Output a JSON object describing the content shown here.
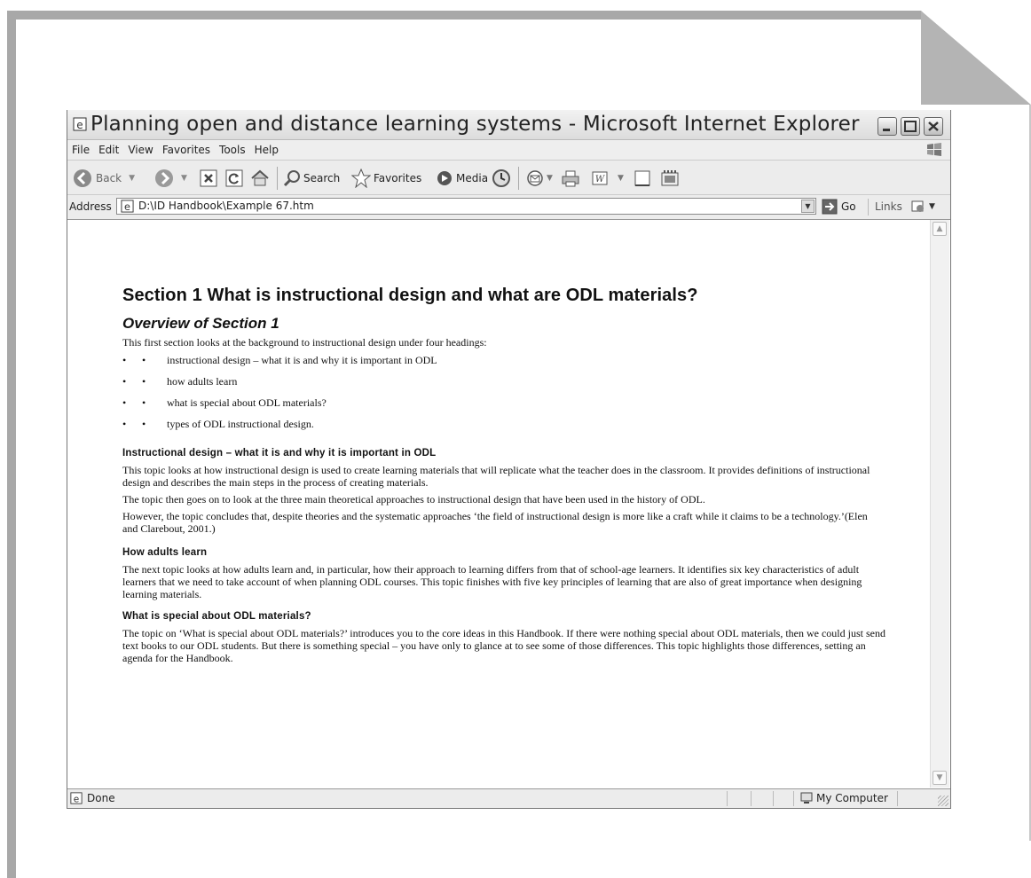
{
  "window": {
    "title": "Planning open and distance learning systems - Microsoft Internet Explorer"
  },
  "menu": [
    "File",
    "Edit",
    "View",
    "Favorites",
    "Tools",
    "Help"
  ],
  "toolbar": {
    "back": "Back",
    "search": "Search",
    "favorites": "Favorites",
    "media": "Media"
  },
  "address": {
    "label": "Address",
    "value": "D:\\ID Handbook\\Example 67.htm",
    "go": "Go",
    "links": "Links"
  },
  "content": {
    "heading": "Section 1 What is instructional design and what are ODL materials?",
    "subheading": "Overview of Section 1",
    "intro": "This first section looks at the background to instructional design under four headings:",
    "bullet_glyph": "•",
    "bullets": [
      "instructional design – what it is and why it is important in ODL",
      "how adults learn",
      "what is special about ODL materials?",
      "types of ODL instructional design."
    ],
    "sections": [
      {
        "title": "Instructional design – what it is and why it is important in ODL",
        "paragraphs": [
          "This topic looks at how instructional design is used to create learning materials that will replicate what the teacher does in the classroom. It provides definitions of instructional design and describes the main steps in the process of creating materials.",
          "The topic then goes on to look at the three main theoretical approaches to instructional design that have been used in the history of ODL.",
          "However, the topic concludes that, despite theories and the systematic approaches ‘the field of instructional design is more like a craft while it claims to be a technology.’(Elen and Clarebout, 2001.)"
        ]
      },
      {
        "title": "How adults learn",
        "paragraphs": [
          "The next topic looks at how adults learn and, in particular, how their approach to learning differs from that of school-age learners. It identifies six key characteristics of adult learners that we need to take account of when planning ODL courses. This topic finishes with five key principles of learning that are also of great importance when designing learning materials."
        ]
      },
      {
        "title": "What is special about ODL materials?",
        "paragraphs": [
          "The topic on ‘What is special about ODL materials?’ introduces you to the core ideas in this Handbook. If there were nothing special about ODL materials, then we could just send text books to our ODL students. But there is something special – you have only to glance at  to see some of those differences. This topic highlights those differences, setting an agenda for the Handbook."
        ]
      }
    ]
  },
  "status": {
    "left": "Done",
    "zone": "My Computer"
  },
  "icons": [
    "ie-page-icon",
    "minimize-icon",
    "maximize-icon",
    "close-icon",
    "windows-logo-icon",
    "back-icon",
    "forward-icon",
    "stop-icon",
    "refresh-icon",
    "home-icon",
    "search-icon",
    "favorites-star-icon",
    "media-icon",
    "history-icon",
    "mail-icon",
    "print-icon",
    "edit-word-icon",
    "discuss-icon",
    "messenger-icon",
    "dropdown-icon",
    "go-arrow-icon",
    "links-icon",
    "computer-icon"
  ]
}
